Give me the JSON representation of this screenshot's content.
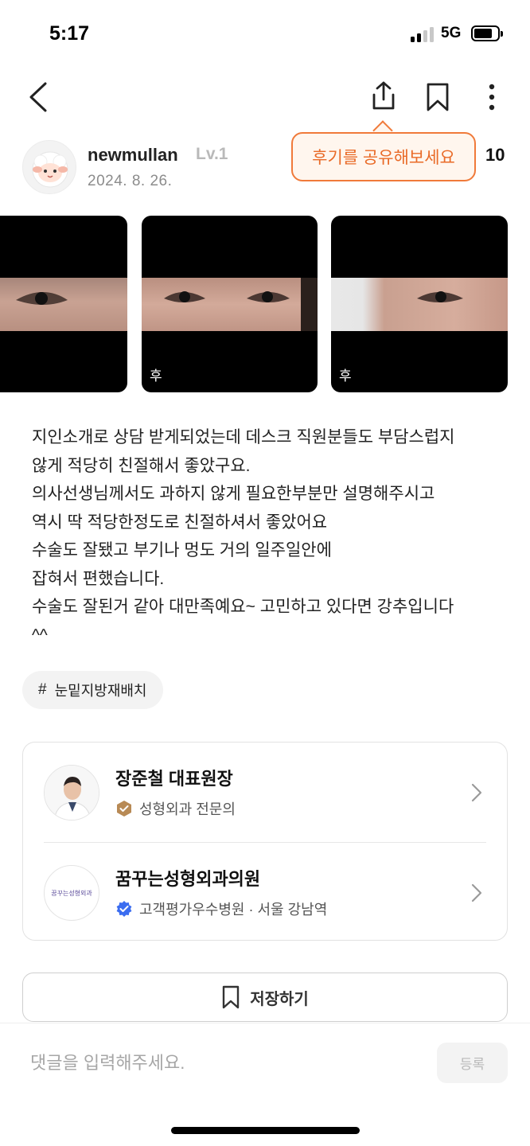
{
  "status_bar": {
    "time": "5:17",
    "network": "5G",
    "signal_bars": 2,
    "battery_level": 0.7
  },
  "nav": {
    "icons": [
      "back-icon",
      "share-icon",
      "bookmark-icon",
      "more-icon"
    ]
  },
  "tooltip": {
    "text": "후기를 공유해보세요",
    "count": "10"
  },
  "author": {
    "username": "newmullan",
    "level": "Lv.1",
    "date": "2024. 8. 26."
  },
  "photos": [
    {
      "label": ""
    },
    {
      "label": "후"
    },
    {
      "label": "후"
    }
  ],
  "review": {
    "lines": [
      "지인소개로 상담 받게되었는데 데스크 직원분들도 부담스럽지",
      "않게 적당히 친절해서 좋았구요.",
      "의사선생님께서도 과하지 않게 필요한부분만 설명해주시고",
      "역시 딱 적당한정도로 친절하셔서 좋았어요",
      "수술도 잘됐고 부기나 멍도 거의 일주일안에",
      "잡혀서 편했습니다.",
      "수술도 잘된거 같아 대만족예요~ 고민하고 있다면 강추입니다",
      "^^"
    ]
  },
  "tag": {
    "hash": "#",
    "label": "눈밑지방재배치"
  },
  "doctor": {
    "name": "장준철 대표원장",
    "specialty": "성형외과 전문의"
  },
  "clinic": {
    "name": "꿈꾸는성형외과의원",
    "info": "고객평가우수병원 · 서울 강남역",
    "logo_text": "꿈꾸는성형외과"
  },
  "save_button": {
    "label": "저장하기"
  },
  "comment": {
    "placeholder": "댓글을 입력해주세요.",
    "submit_label": "등록"
  },
  "colors": {
    "accent": "#f07a3a",
    "tooltip_bg": "#fff6ee",
    "badge_brown": "#b88a55",
    "badge_blue": "#3b6df0"
  }
}
